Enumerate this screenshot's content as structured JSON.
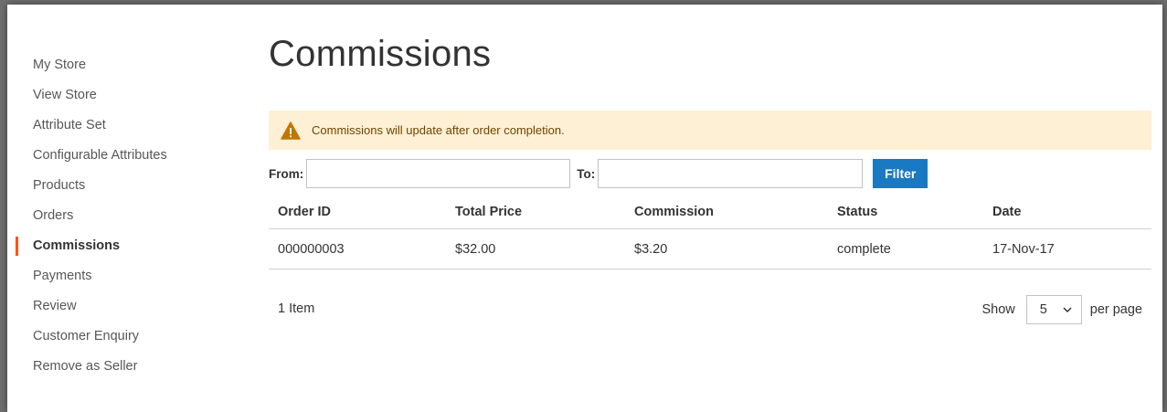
{
  "sidebar": {
    "items": [
      {
        "label": "My Store"
      },
      {
        "label": "View Store"
      },
      {
        "label": "Attribute Set"
      },
      {
        "label": "Configurable Attributes"
      },
      {
        "label": "Products"
      },
      {
        "label": "Orders"
      },
      {
        "label": "Commissions",
        "active": true
      },
      {
        "label": "Payments"
      },
      {
        "label": "Review"
      },
      {
        "label": "Customer Enquiry"
      },
      {
        "label": "Remove as Seller"
      }
    ],
    "accent_color": "#ff5501"
  },
  "page": {
    "title": "Commissions"
  },
  "notice": {
    "icon": "warning-icon",
    "text": "Commissions will update after order completion.",
    "background": "#fdf0d5"
  },
  "filter": {
    "from_label": "From:",
    "from_value": "",
    "to_label": "To:",
    "to_value": "",
    "button_label": "Filter",
    "button_color": "#1979c3"
  },
  "table": {
    "headers": [
      "Order ID",
      "Total Price",
      "Commission",
      "Status",
      "Date"
    ],
    "rows": [
      [
        "000000003",
        "$32.00",
        "$3.20",
        "complete",
        "17-Nov-17"
      ]
    ]
  },
  "pagination": {
    "items_count": "1 Item",
    "show_label": "Show",
    "limit_value": "5",
    "per_page_label": "per page"
  }
}
